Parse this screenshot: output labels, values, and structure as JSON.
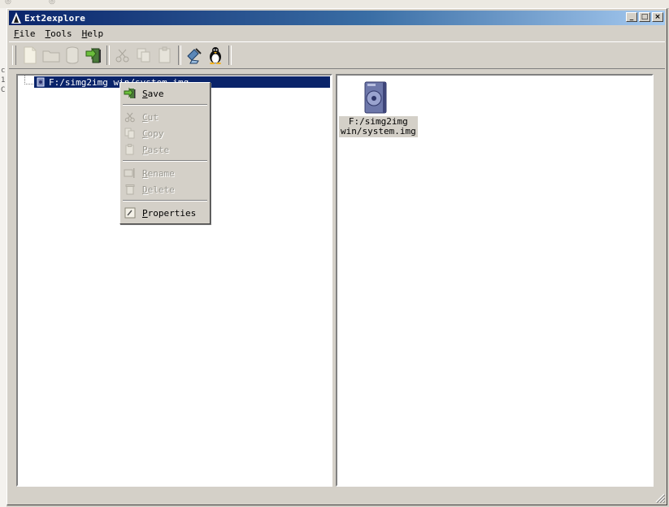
{
  "window": {
    "title": "Ext2explore",
    "controls": {
      "minimize": "_",
      "maximize": "□",
      "close": "×"
    }
  },
  "menubar": {
    "items": [
      {
        "label": "File"
      },
      {
        "label": "Tools"
      },
      {
        "label": "Help"
      }
    ]
  },
  "toolbar": {
    "buttons": [
      {
        "icon": "new-file-icon",
        "enabled": false
      },
      {
        "icon": "open-folder-icon",
        "enabled": false
      },
      {
        "icon": "database-icon",
        "enabled": false
      },
      {
        "icon": "save-export-icon",
        "enabled": true
      },
      {
        "icon": "cut-icon",
        "enabled": false
      },
      {
        "icon": "copy-icon",
        "enabled": false
      },
      {
        "icon": "paste-icon",
        "enabled": false
      },
      {
        "icon": "flashlight-icon",
        "enabled": true
      },
      {
        "icon": "linux-tux-icon",
        "enabled": true
      }
    ]
  },
  "tree": {
    "selected_node": {
      "label": "F:/simg2img win/system.img",
      "icon": "disk-image-icon"
    }
  },
  "file_view": {
    "items": [
      {
        "label": "F:/simg2img\nwin/system.img",
        "icon": "disk-image-icon"
      }
    ]
  },
  "context_menu": {
    "items": [
      {
        "label": "Save",
        "icon": "save-export-icon",
        "enabled": true
      },
      {
        "label": "Cut",
        "icon": "cut-icon",
        "enabled": false
      },
      {
        "label": "Copy",
        "icon": "copy-icon",
        "enabled": false
      },
      {
        "label": "Paste",
        "icon": "paste-icon",
        "enabled": false
      },
      {
        "label": "Rename",
        "icon": "rename-icon",
        "enabled": false
      },
      {
        "label": "Delete",
        "icon": "delete-icon",
        "enabled": false
      },
      {
        "label": "Properties",
        "icon": "properties-icon",
        "enabled": true
      }
    ]
  },
  "colors": {
    "selection": "#0a246a",
    "face": "#d4d0c8",
    "titlebar_start": "#0a246a",
    "titlebar_end": "#a6caf0"
  }
}
